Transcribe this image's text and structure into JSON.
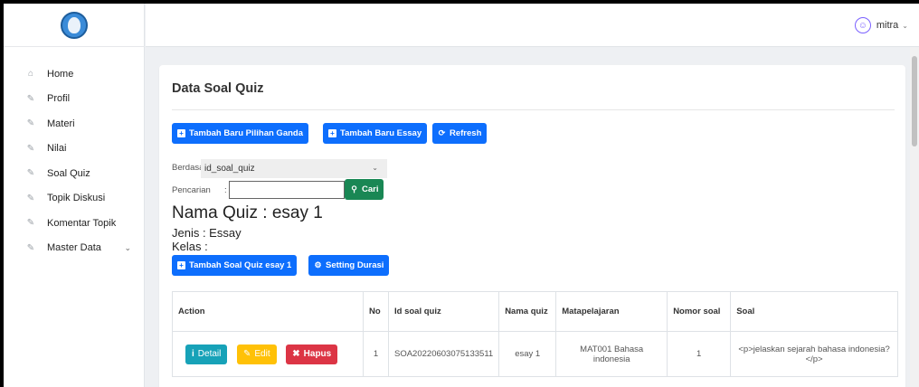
{
  "sidebar": {
    "items": [
      {
        "label": "Home",
        "icon": "home-icon"
      },
      {
        "label": "Profil",
        "icon": "edit-icon"
      },
      {
        "label": "Materi",
        "icon": "edit-icon"
      },
      {
        "label": "Nilai",
        "icon": "edit-icon"
      },
      {
        "label": "Soal Quiz",
        "icon": "edit-icon"
      },
      {
        "label": "Topik Diskusi",
        "icon": "edit-icon"
      },
      {
        "label": "Komentar Topik",
        "icon": "edit-icon"
      },
      {
        "label": "Master Data",
        "icon": "edit-icon"
      }
    ]
  },
  "header": {
    "user": "mitra"
  },
  "main": {
    "title": "Data Soal Quiz",
    "buttons": {
      "add_pg": "Tambah Baru Pilihan Ganda",
      "add_essay": "Tambah Baru Essay",
      "refresh": "Refresh"
    },
    "filter": {
      "by_label": "Berdasarkan:",
      "by_value": "id_soal_quiz",
      "search_label": "Pencarian",
      "search_sep": ":",
      "search_value": "",
      "search_button": "Cari"
    },
    "quiz": {
      "name": "Nama Quiz : esay 1",
      "type": "Jenis : Essay",
      "class": "Kelas :"
    },
    "quiz_buttons": {
      "add_soal": "Tambah Soal Quiz esay 1",
      "setting": "Setting Durasi"
    },
    "table": {
      "headers": [
        "Action",
        "No",
        "Id soal quiz",
        "Nama quiz",
        "Matapelajaran",
        "Nomor soal",
        "Soal"
      ],
      "rows": [
        {
          "no": "1",
          "id": "SOA20220603075133511",
          "nama": "esay 1",
          "mapel": "MAT001 Bahasa indonesia",
          "nomor": "1",
          "soal": "<p>jelaskan sejarah bahasa indonesia?</p>",
          "actions": {
            "detail": "Detail",
            "edit": "Edit",
            "hapus": "Hapus"
          }
        }
      ]
    }
  },
  "colors": {
    "primary": "#0d6efd",
    "success": "#198754",
    "info": "#17a2b8",
    "warning": "#ffc107",
    "danger": "#dc3545"
  }
}
